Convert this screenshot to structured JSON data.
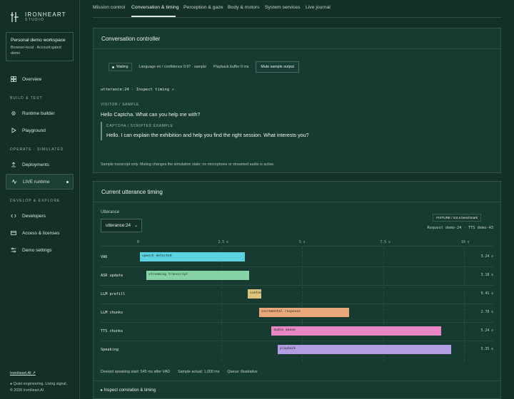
{
  "brand": {
    "name": "IRONHEART",
    "sub": "STUDIO"
  },
  "workspace": {
    "title": "Personal demo workspace",
    "subtitle": "Browser-local · Account-gated demo"
  },
  "nav": {
    "overview": "Overview",
    "build_label": "BUILD & TEST",
    "runtime_builder": "Runtime builder",
    "playground": "Playground",
    "operate_label": "OPERATE · SIMULATED",
    "deployments": "Deployments",
    "live_runtime": "LIVE runtime",
    "develop_label": "DEVELOP & EXPLORE",
    "developers": "Developers",
    "access": "Access & licenses",
    "demo_settings": "Demo settings"
  },
  "footer": {
    "link": "IronHeart.AI ↗",
    "tagline": "● Quiet engineering. Living signal.",
    "copyright": "© 2026 IronHeart.AI"
  },
  "tabs": [
    "Mission control",
    "Conversation & timing",
    "Perception & gaze",
    "Body & motors",
    "System services",
    "Live journal"
  ],
  "active_tab": "Conversation & timing",
  "controller": {
    "title": "Conversation controller",
    "status_pill": "Waiting",
    "language": "Language en / confidence 0.97 · sample",
    "playback": "Playback buffer 0 ms",
    "mute_button": "Mute sample output",
    "utterance_link": "utterance:24 · Inspect timing ↗",
    "visitor_label": "VISITOR / SAMPLE",
    "visitor_text": "Hello Captcha. What can you help me with?",
    "reply_label": "CAPTCHA / SCRIPTED EXAMPLE",
    "reply_text": "Hello. I can explain the exhibition and help you find the right session. What interests you?",
    "note": "Sample transcript only. Muting changes the simulation state; no microphone or streamed audio is active."
  },
  "timing": {
    "title": "Current utterance timing",
    "utterance_label": "Utterance",
    "utterance_value": "utterance:24",
    "fixture_badge": "FIXTURE / not a benchmark",
    "request": "Request demo-24 · TTS demo-43",
    "footer": {
      "desired": "Desired speaking start: 545 ms after VAD",
      "actual": "Sample actual: 1,000 ms",
      "queue": "Queue: illustrative"
    },
    "inspect": "▸ Inspect correlation & timing"
  },
  "chart_data": {
    "type": "gantt",
    "x_ticks": [
      "0",
      "2.5 s",
      "5 s",
      "7.5 s",
      "10 s"
    ],
    "xlim": [
      0,
      10
    ],
    "rows": [
      {
        "label": "VAD",
        "start": 0,
        "end": 3.24,
        "bar_label": "speech detected",
        "value": "3.24 s",
        "color": "#5ad2e0"
      },
      {
        "label": "ASR update",
        "start": 0.2,
        "end": 3.38,
        "bar_label": "streaming transcript",
        "value": "3.18 s",
        "color": "#86d3a6"
      },
      {
        "label": "LLM prefill",
        "start": 3.33,
        "end": 3.74,
        "bar_label": "context",
        "value": "0.41 s",
        "color": "#dcc27e"
      },
      {
        "label": "LLM chunks",
        "start": 3.67,
        "end": 6.45,
        "bar_label": "incremental response",
        "value": "2.78 s",
        "color": "#e9a87a"
      },
      {
        "label": "TTS chunks",
        "start": 4.06,
        "end": 9.3,
        "bar_label": "audio queue",
        "value": "5.24 s",
        "color": "#e986c5"
      },
      {
        "label": "Speaking",
        "start": 4.25,
        "end": 9.6,
        "bar_label": "playback",
        "value": "5.35 s",
        "color": "#b39ee3"
      }
    ]
  }
}
